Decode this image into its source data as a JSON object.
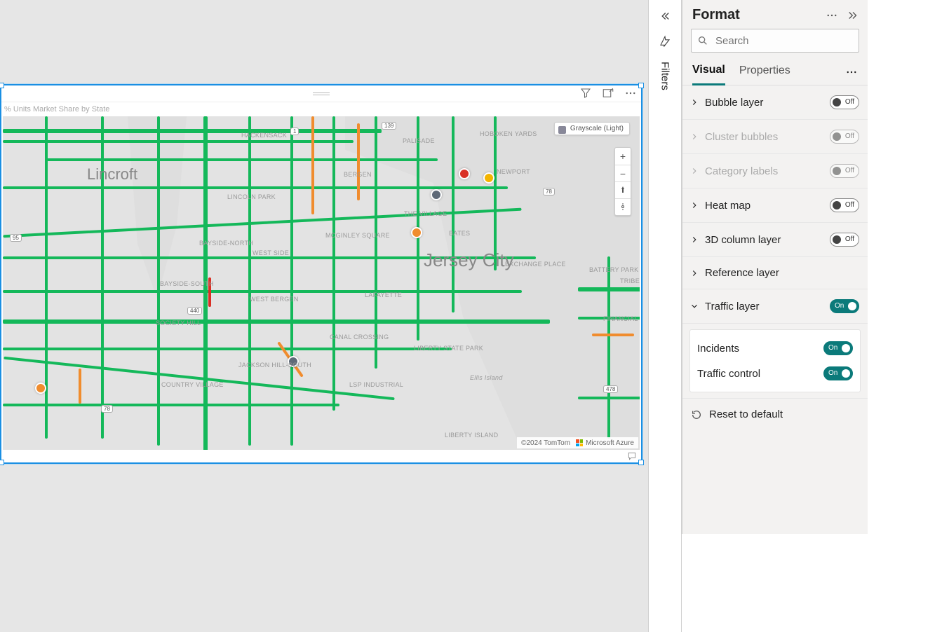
{
  "panel": {
    "title": "Format",
    "search_placeholder": "Search",
    "tabs": {
      "visual": "Visual",
      "properties": "Properties"
    },
    "layers": {
      "bubble": "Bubble layer",
      "cluster": "Cluster bubbles",
      "category": "Category labels",
      "heat": "Heat map",
      "col3d": "3D column layer",
      "reference": "Reference layer",
      "traffic": "Traffic layer"
    },
    "toggle": {
      "on": "On",
      "off": "Off"
    },
    "sub": {
      "incidents": "Incidents",
      "traffic_control": "Traffic control"
    },
    "reset": "Reset to default"
  },
  "filters_rail": {
    "label": "Filters"
  },
  "visual": {
    "title": "% Units Market Share by State"
  },
  "map": {
    "style_badge": "Grayscale (Light)",
    "city": "Jersey City",
    "small_city": "Lincroft",
    "areas": [
      "HACKENSACK",
      "PALISADE",
      "HOBOKEN YARDS",
      "NEWPORT",
      "LINCOLN PARK",
      "BERGEN",
      "BAYSIDE-NORTH",
      "WEST SIDE",
      "MCGINLEY SQUARE",
      "THE VILLAGE",
      "BATES",
      "EXCHANGE PLACE",
      "BAYSIDE-SOUTH",
      "WEST BERGEN",
      "LAFAYETTE",
      "SOCIETY HILL",
      "CANAL CROSSING",
      "LIBERTY STATE PARK",
      "JACKSON HILL-SOUTH",
      "COUNTRY VILLAGE",
      "LSP INDUSTRIAL",
      "BATTERY PARK CITY",
      "FINANCIAL DISTRICT",
      "TRIBECA",
      "Ellis Island",
      "LIBERTY ISLAND"
    ],
    "routes": [
      "139",
      "1",
      "78",
      "95",
      "440",
      "78",
      "478"
    ],
    "attribution_tomtom": "©2024 TomTom",
    "attribution_azure": "Microsoft Azure"
  }
}
